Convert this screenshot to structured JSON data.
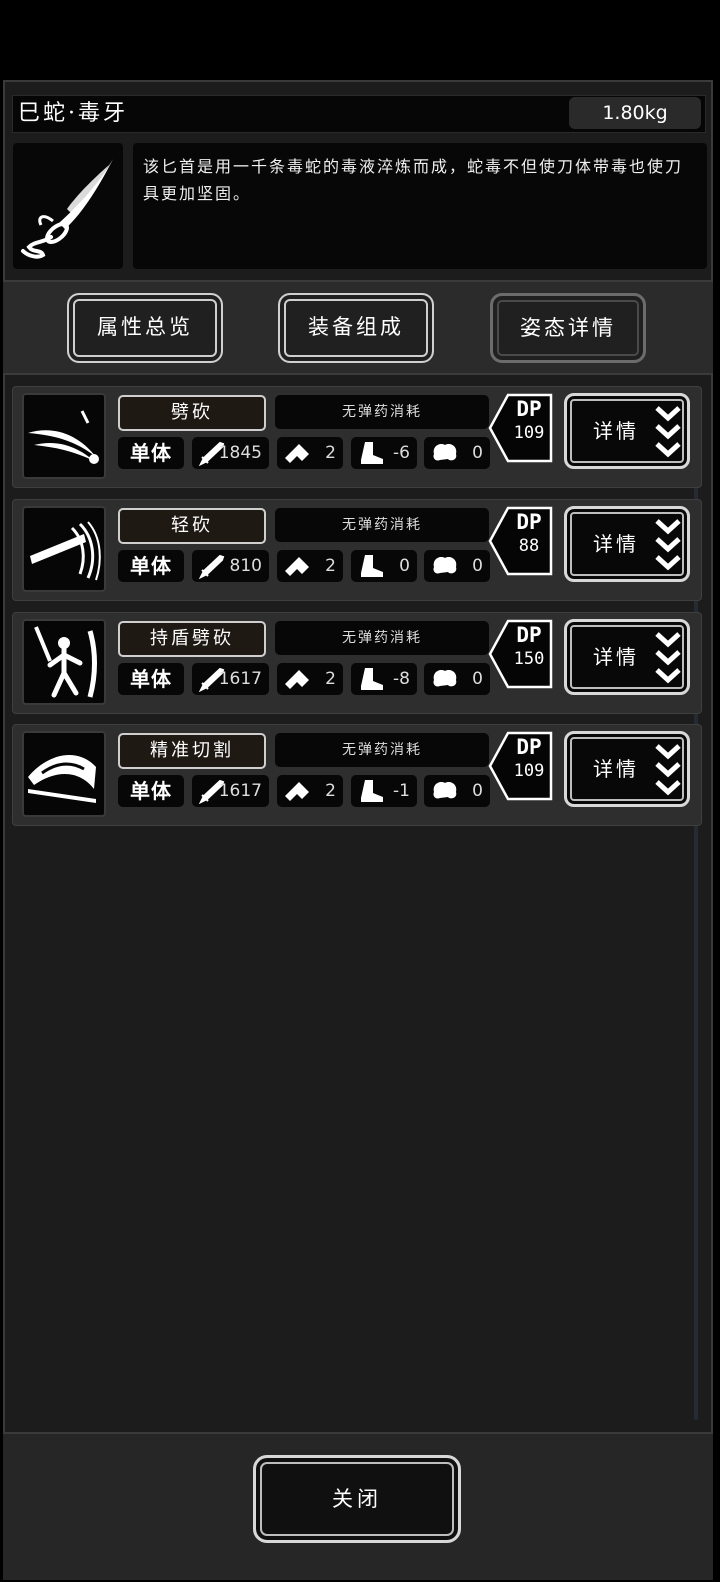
{
  "item": {
    "name": "巳蛇·毒牙",
    "weight": "1.80kg",
    "description": "该匕首是用一千条毒蛇的毒液淬炼而成，蛇毒不但使刀体带毒也使刀具更加坚固。"
  },
  "tabs": [
    {
      "label": "属性总览"
    },
    {
      "label": "装备组成"
    },
    {
      "label": "姿态详情"
    }
  ],
  "skills": [
    {
      "name": "劈砍",
      "ammo": "无弹药消耗",
      "target": "单体",
      "attack": "1845",
      "hit": "2",
      "move": "-6",
      "mind": "0",
      "dp_label": "DP",
      "dp": "109",
      "detail_label": "详情"
    },
    {
      "name": "轻砍",
      "ammo": "无弹药消耗",
      "target": "单体",
      "attack": "810",
      "hit": "2",
      "move": "0",
      "mind": "0",
      "dp_label": "DP",
      "dp": "88",
      "detail_label": "详情"
    },
    {
      "name": "持盾劈砍",
      "ammo": "无弹药消耗",
      "target": "单体",
      "attack": "1617",
      "hit": "2",
      "move": "-8",
      "mind": "0",
      "dp_label": "DP",
      "dp": "150",
      "detail_label": "详情"
    },
    {
      "name": "精准切割",
      "ammo": "无弹药消耗",
      "target": "单体",
      "attack": "1617",
      "hit": "2",
      "move": "-1",
      "mind": "0",
      "dp_label": "DP",
      "dp": "109",
      "detail_label": "详情"
    }
  ],
  "icons": {
    "attack": "sword-icon",
    "hit": "checker-icon",
    "move": "boot-icon",
    "mind": "brain-icon",
    "detail": "triple-chevron-down-icon"
  },
  "footer": {
    "close_label": "关闭"
  }
}
